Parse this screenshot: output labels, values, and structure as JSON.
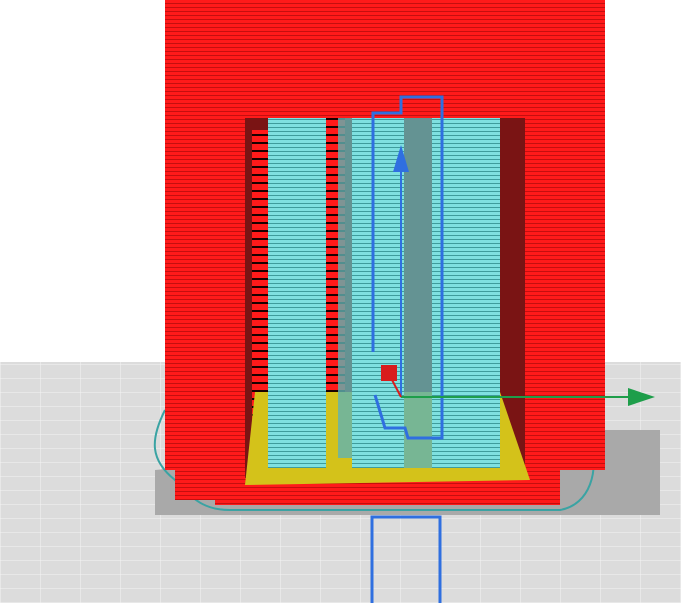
{
  "viewport": {
    "view_mode": "layer-view",
    "colors": {
      "background": "#ffffff",
      "build_plate": "#d9d9d9",
      "grid_line": "#f2f2f2",
      "wall_outer": "#ff1a1a",
      "wall_inner_shadow": "#7a1414",
      "infill_support": "#73d6d6",
      "skin_bottom": "#d4c21a",
      "travel_move": "#2f6fe0",
      "axis_y": "#1e9e4a",
      "axis_x": "#d81c1c",
      "skirt": "#3aa3a3",
      "shadow": "#a8a8a8"
    },
    "icons": [
      "z-axis-arrow-icon",
      "y-axis-arrow-icon",
      "origin-cube-icon"
    ]
  }
}
